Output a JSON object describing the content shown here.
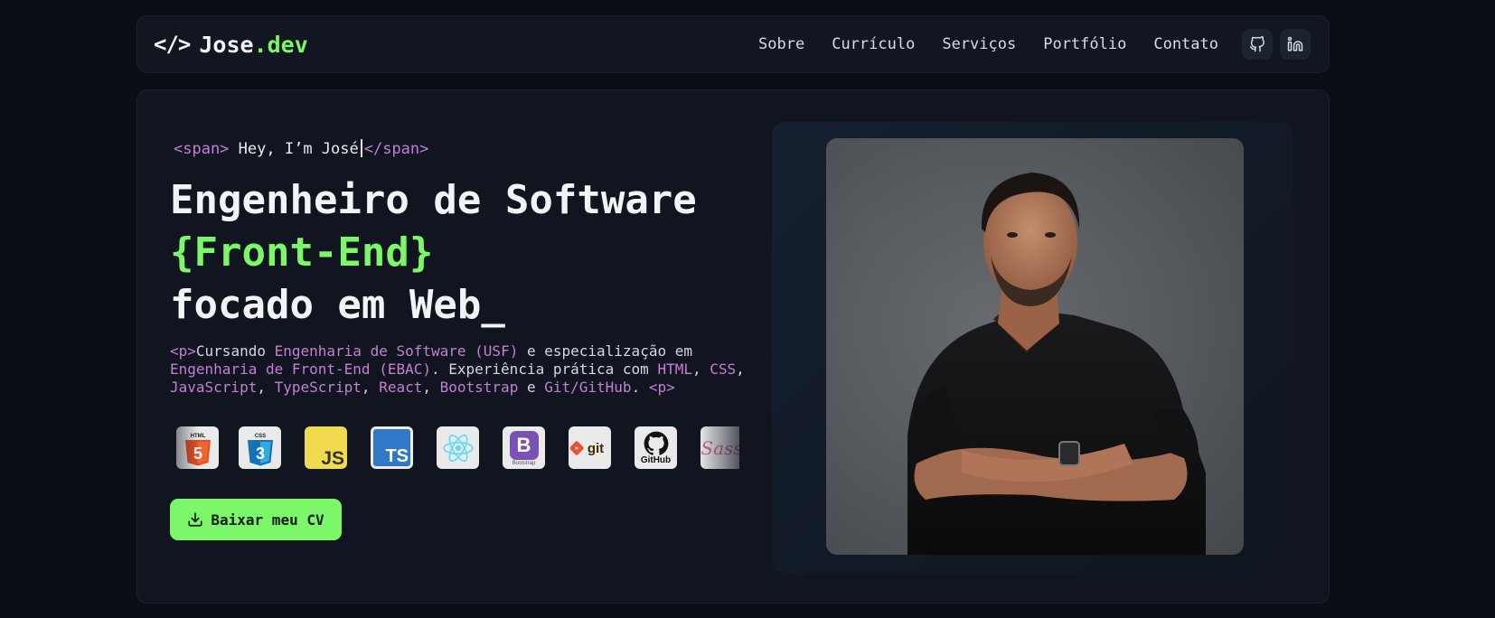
{
  "nav": {
    "brand_code": "</>",
    "brand_name": "Jose",
    "brand_tld": ".dev",
    "links": [
      "Sobre",
      "Currículo",
      "Serviços",
      "Portfólio",
      "Contato"
    ],
    "social_icons": [
      "github-icon",
      "linkedin-icon"
    ]
  },
  "hero": {
    "intro": {
      "tag_open": "<span>",
      "text": "Hey, I’m José",
      "tag_close": "</span>"
    },
    "headline": {
      "line1": "Engenheiro de Software",
      "line2": "{Front-End}",
      "line3": "focado em Web_"
    },
    "description": {
      "tag_open": "<p>",
      "t1": "Cursando ",
      "h1": "Engenharia de Software (USF)",
      "t2": " e especialização em ",
      "h2": "Engenharia de Front-End (EBAC)",
      "t3": ". Experiência prática com ",
      "h3": "HTML",
      "t4": ", ",
      "h4": "CSS",
      "t5": ", ",
      "h5": "JavaScript",
      "t6": ", ",
      "h6": "TypeScript",
      "t7": ", ",
      "h7": "React",
      "t8": ", ",
      "h8": "Bootstrap",
      "t9": " e ",
      "h9": "Git/GitHub",
      "t10": ".",
      "tag_close": "<p>"
    },
    "tech_icons": [
      {
        "name": "html5-icon",
        "label": "HTML"
      },
      {
        "name": "css3-icon",
        "label": "CSS"
      },
      {
        "name": "javascript-icon",
        "label": "JS"
      },
      {
        "name": "typescript-icon",
        "label": "TS"
      },
      {
        "name": "react-icon",
        "label": ""
      },
      {
        "name": "bootstrap-icon",
        "label": "B"
      },
      {
        "name": "git-icon",
        "label": "git"
      },
      {
        "name": "github-icon",
        "label": "GitHub"
      },
      {
        "name": "sass-icon",
        "label": "Sass"
      }
    ],
    "tech_sublabel_bootstrap": "Bootstrap",
    "cv_button": "Baixar meu CV",
    "photo_alt": "José"
  },
  "colors": {
    "accent": "#7cf76a",
    "tag": "#c77dd8",
    "background": "#0a0e15",
    "card": "#101520"
  }
}
